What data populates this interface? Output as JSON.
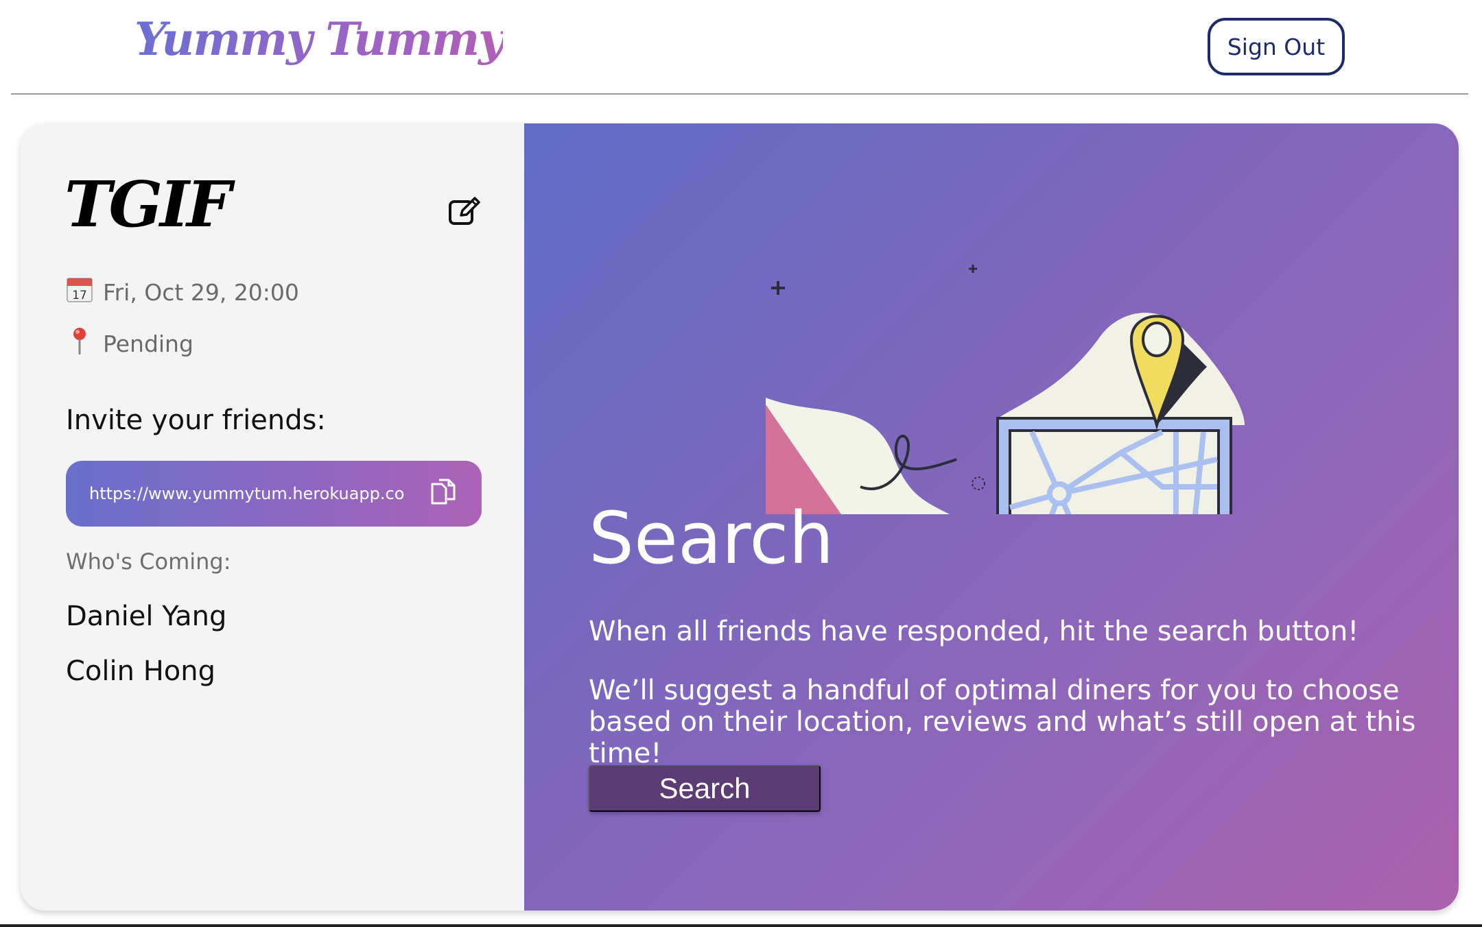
{
  "header": {
    "logo": "Yummy Tummy",
    "sign_out_label": "Sign Out"
  },
  "event": {
    "title": "TGIF",
    "date_icon": "calendar-icon",
    "date": "Fri, Oct 29, 20:00",
    "location_icon": "pin-icon",
    "location": "Pending",
    "invite_label": "Invite your friends:",
    "invite_link": "https://www.yummytum.herokuapp.com",
    "coming_label": "Who's Coming:",
    "attendees": [
      "Daniel Yang",
      "Colin Hong"
    ]
  },
  "search_panel": {
    "heading": "Search",
    "description_1": "When all friends have responded, hit the search button!",
    "description_2": "We’ll suggest a handful of optimal diners for you to choose based on their location, reviews and what’s still open at this time!",
    "button_label": "Search"
  },
  "colors": {
    "brand_gradient_start": "#6b6fd4",
    "brand_gradient_end": "#b060b6",
    "sign_out_border": "#1d2a6b",
    "search_button": "#5c3c74"
  }
}
